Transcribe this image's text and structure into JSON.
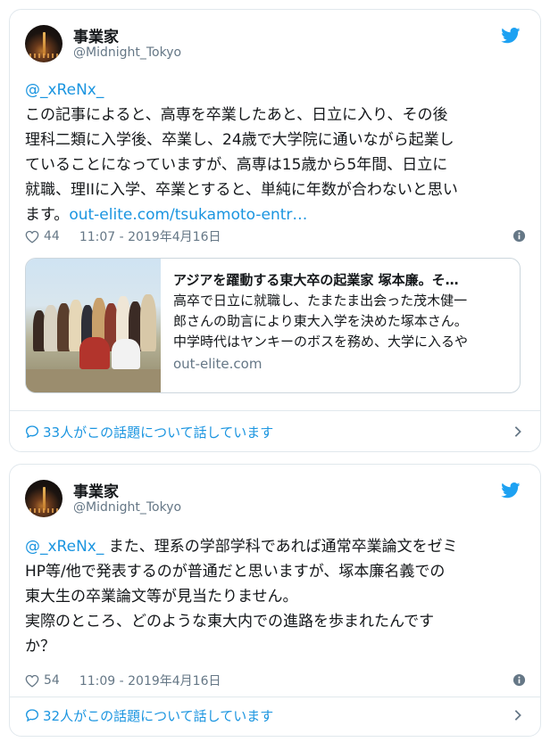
{
  "tweets": [
    {
      "author_name": "事業家",
      "author_handle": "@Midnight_Tokyo",
      "mention": "@_xReNx_",
      "body": "この記事によると、高専を卒業したあと、日立に入り、その後\n理科二類に入学後、卒業し、24歳で大学院に通いながら起業し\nていることになっていますが、高専は15歳から5年間、日立に\n就職、理IIに入学、卒業とすると、単純に年数が合わないと思い\nます。",
      "link_text": "out-elite.com/tsukamoto-entr…",
      "likes": "44",
      "timestamp": "11:07 - 2019年4月16日",
      "card": {
        "title": "アジアを躍動する東大卒の起業家 塚本廉。そ…",
        "description": "高卒で日立に就職し、たまたま出会った茂木健一\n郎さんの助言により東大入学を決めた塚本さん。\n中学時代はヤンキーのボスを務め、大学に入るや",
        "domain": "out-elite.com"
      },
      "conversation": "33人がこの話題について話しています"
    },
    {
      "author_name": "事業家",
      "author_handle": "@Midnight_Tokyo",
      "mention": "@_xReNx_",
      "body": " また、理系の学部学科であれば通常卒業論文をゼミ\nHP等/他で発表するのが普通だと思いますが、塚本廉名義での\n東大生の卒業論文等が見当たりません。\n実際のところ、どのような東大内での進路を歩まれたんです\nか？",
      "likes": "54",
      "timestamp": "11:09 - 2019年4月16日",
      "conversation": "32人がこの話題について話しています"
    }
  ],
  "colors": {
    "link": "#1b95e0",
    "muted": "#657786",
    "border": "#e1e8ed"
  },
  "icons": [
    "twitter-bird-icon",
    "heart-icon",
    "info-icon",
    "speech-bubble-icon",
    "chevron-right-icon"
  ]
}
